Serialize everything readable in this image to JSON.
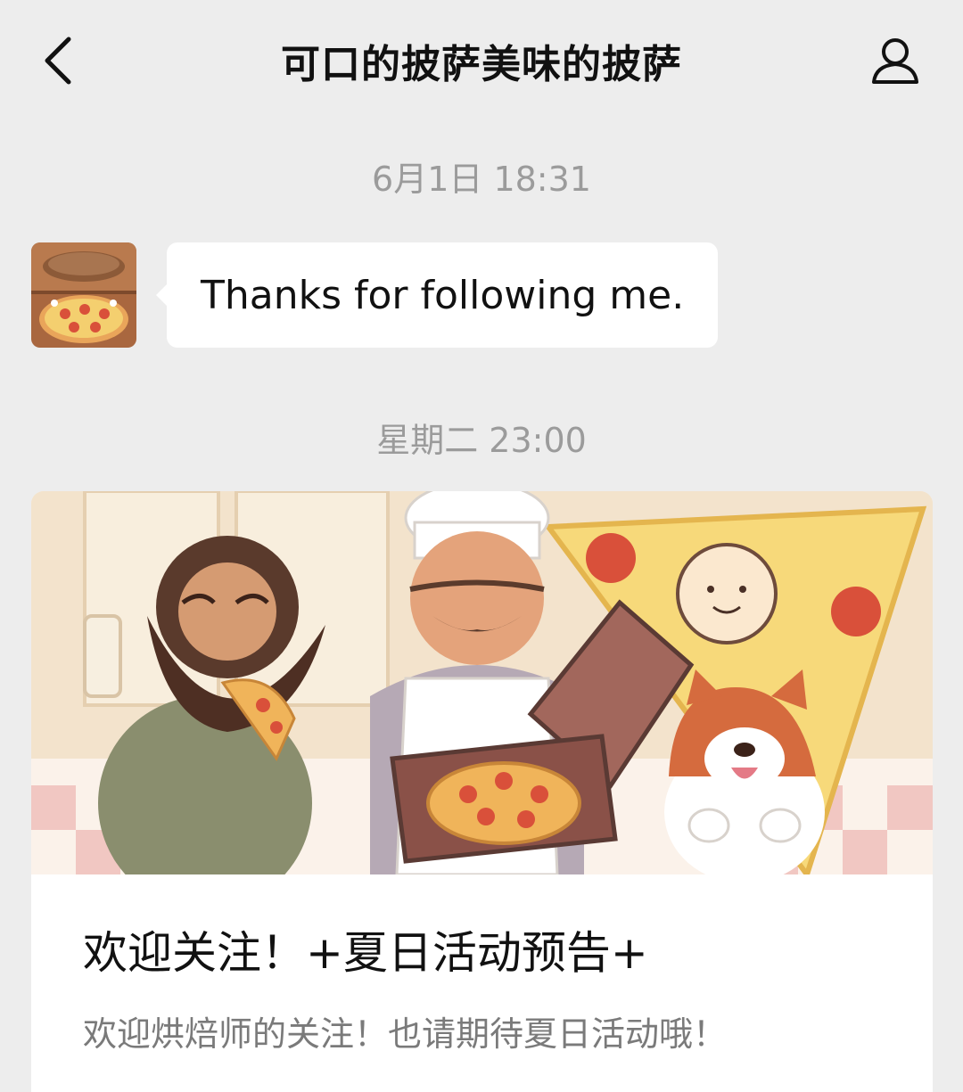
{
  "nav": {
    "title": "可口的披萨美味的披萨",
    "back_icon": "chevron-left-icon",
    "profile_icon": "user-icon"
  },
  "chat": {
    "timestamps": [
      "6月1日 18:31",
      "星期二 23:00"
    ],
    "messages": [
      {
        "sender": "pizza-account",
        "text": "Thanks for following me."
      }
    ]
  },
  "article_card": {
    "title": "欢迎关注！+夏日活动预告+",
    "description": "欢迎烘焙师的关注！也请期待夏日活动哦！"
  },
  "colors": {
    "background": "#ededed",
    "bubble": "#ffffff",
    "timestamp_text": "#9b9b9b",
    "description_text": "#7a7a7a"
  }
}
